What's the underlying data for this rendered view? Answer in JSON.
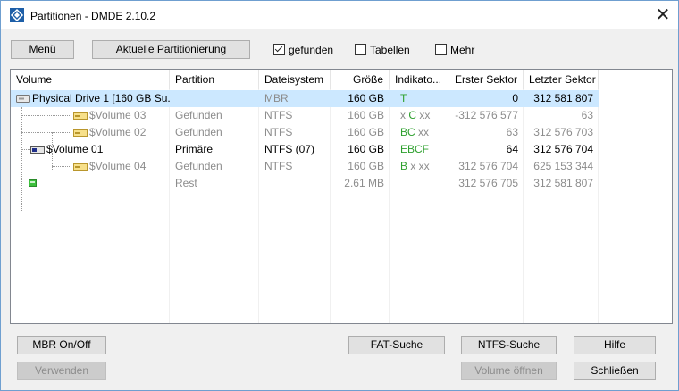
{
  "window": {
    "title": "Partitionen - DMDE 2.10.2"
  },
  "toolbar": {
    "menu_label": "Menü",
    "current_label": "Aktuelle Partitionierung",
    "checkboxes": [
      {
        "label": "gefunden",
        "checked": true
      },
      {
        "label": "Tabellen",
        "checked": false
      },
      {
        "label": "Mehr",
        "checked": false
      }
    ]
  },
  "table": {
    "columns": [
      "Volume",
      "Partition",
      "Dateisystem",
      "Größe",
      "Indikato...",
      "Erster Sektor",
      "Letzter Sektor"
    ],
    "rows": [
      {
        "volume": "Physical Drive 1 [160 GB Su...",
        "partition": "",
        "fs": "MBR",
        "size": "160 GB",
        "ind": "T",
        "first": "0",
        "last": "312 581 807",
        "selected": true
      },
      {
        "volume": "$Volume 03",
        "partition": "Gefunden",
        "fs": "NTFS",
        "size": "160 GB",
        "ind": "x C xx",
        "first": "-312 576 577",
        "last": "63"
      },
      {
        "volume": "$Volume 02",
        "partition": "Gefunden",
        "fs": "NTFS",
        "size": "160 GB",
        "ind": "BC xx",
        "first": "63",
        "last": "312 576 703"
      },
      {
        "volume": "$Volume 01",
        "partition": "Primäre",
        "fs": "NTFS (07)",
        "size": "160 GB",
        "ind": "EBCF",
        "first": "64",
        "last": "312 576 704"
      },
      {
        "volume": "$Volume 04",
        "partition": "Gefunden",
        "fs": "NTFS",
        "size": "160 GB",
        "ind": "B x xx",
        "first": "312 576 704",
        "last": "625 153 344"
      },
      {
        "volume": "",
        "partition": "Rest",
        "fs": "",
        "size": "2.61 MB",
        "ind": "",
        "first": "312 576 705",
        "last": "312 581 807"
      }
    ]
  },
  "buttons": {
    "mbr": "MBR On/Off",
    "use": "Verwenden",
    "fat": "FAT-Suche",
    "ntfs": "NTFS-Suche",
    "open_volume": "Volume öffnen",
    "help": "Hilfe",
    "close": "Schließen"
  },
  "colors": {
    "selection": "#cce8ff",
    "green_indicator": "#2ea02e",
    "accent": "#1e5fa8"
  }
}
